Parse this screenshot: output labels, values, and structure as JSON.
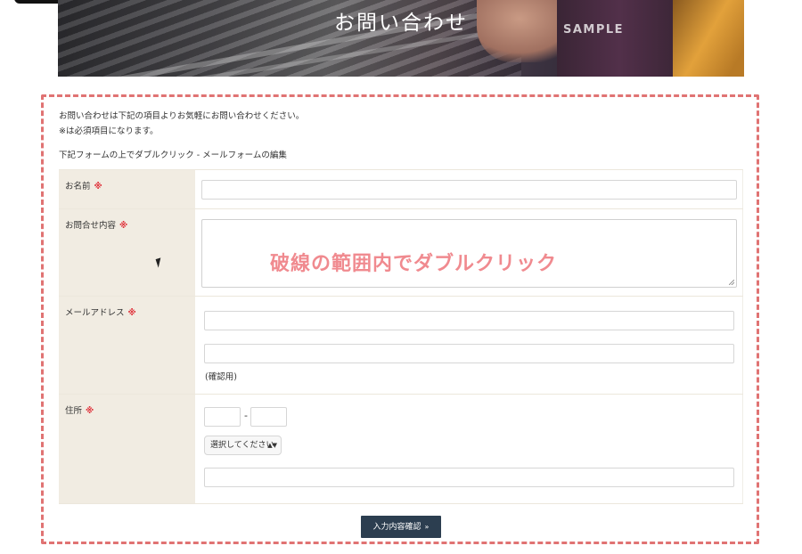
{
  "hero": {
    "title": "お問い合わせ",
    "sample_label": "SAMPLE"
  },
  "intro": {
    "line1": "お問い合わせは下記の項目よりお気軽にお問い合わせください。",
    "line2_mark": "※",
    "line2_text": "は必須項目になります。",
    "line3": "下記フォームの上でダブルクリック - メールフォームの編集"
  },
  "form": {
    "required_mark": "※",
    "name_label": "お名前",
    "message_label": "お問合せ内容",
    "email_label": "メールアドレス",
    "email_confirm_note": "(確認用)",
    "address_label": "住所",
    "zip_separator": "-",
    "prefecture_select": "選択してください",
    "select_arrow": "▲▼"
  },
  "overlay_text": "破線の範囲内でダブルクリック",
  "submit": {
    "label": "入力内容確認",
    "mark": "»"
  },
  "colors": {
    "dashed_border": "#e07373",
    "overlay_text": "#f08a8f",
    "required": "#e0343c",
    "label_bg": "#f1ece2",
    "button_bg": "#2c3e50"
  }
}
